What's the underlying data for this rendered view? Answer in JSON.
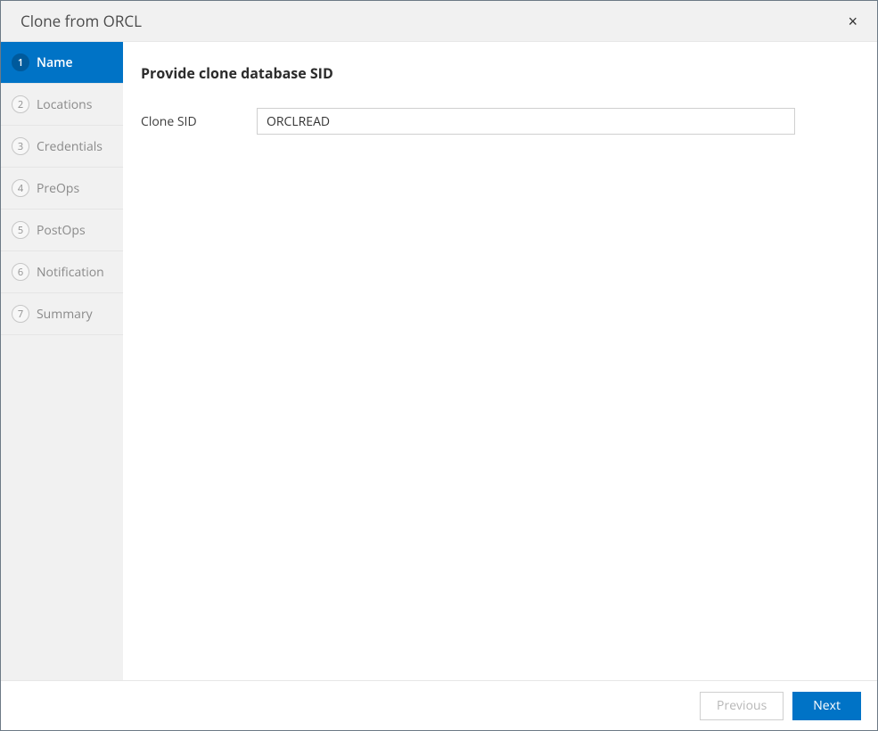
{
  "header": {
    "title": "Clone from ORCL",
    "close_label": "×"
  },
  "sidebar": {
    "steps": [
      {
        "number": "1",
        "label": "Name"
      },
      {
        "number": "2",
        "label": "Locations"
      },
      {
        "number": "3",
        "label": "Credentials"
      },
      {
        "number": "4",
        "label": "PreOps"
      },
      {
        "number": "5",
        "label": "PostOps"
      },
      {
        "number": "6",
        "label": "Notification"
      },
      {
        "number": "7",
        "label": "Summary"
      }
    ]
  },
  "main": {
    "heading": "Provide clone database SID",
    "form": {
      "clone_sid_label": "Clone SID",
      "clone_sid_value": "ORCLREAD"
    }
  },
  "footer": {
    "previous_label": "Previous",
    "next_label": "Next"
  }
}
